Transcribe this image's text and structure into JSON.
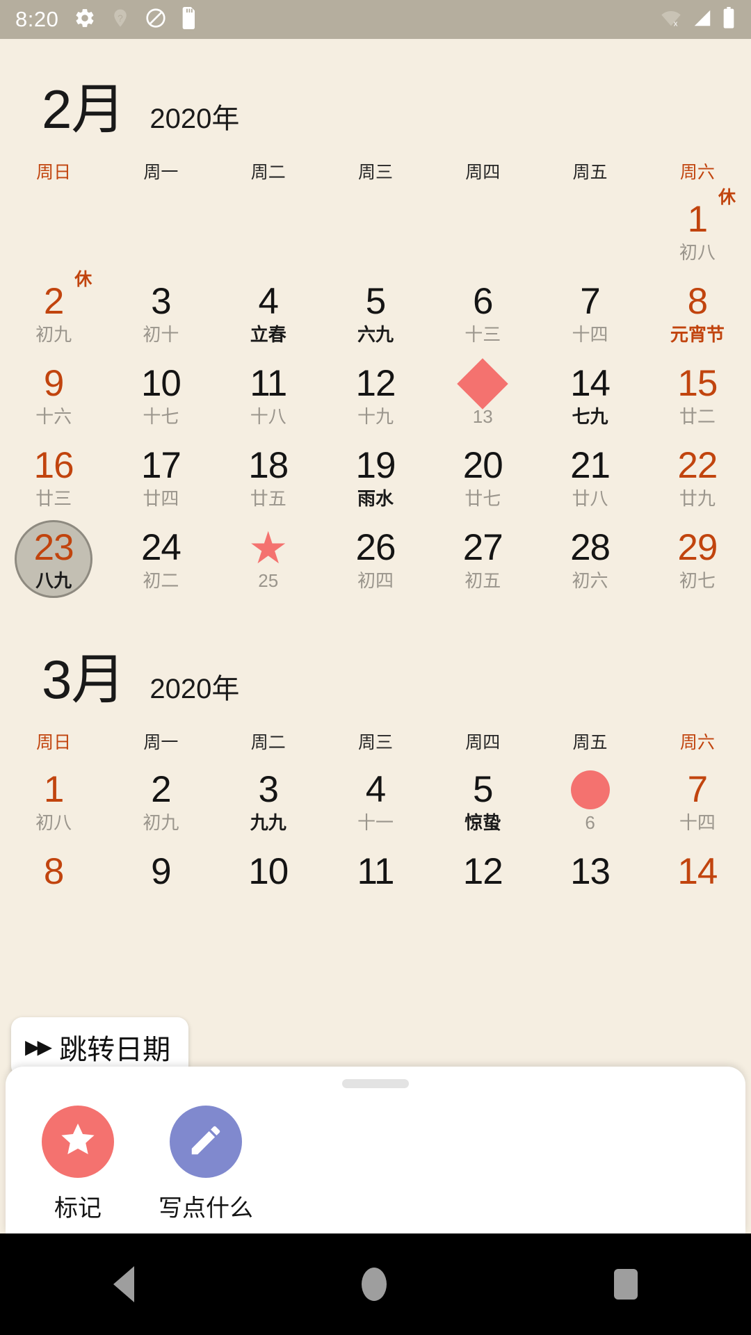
{
  "status_bar": {
    "time": "8:20",
    "left_icons": [
      "gear-icon",
      "location-unknown-icon",
      "do-not-disturb-icon",
      "sd-card-icon"
    ],
    "right_icons": [
      "wifi-off-icon",
      "signal-icon",
      "battery-icon"
    ],
    "background": "#B5AE9E"
  },
  "colors": {
    "page_background": "#F5EEE1",
    "accent_red": "#C1440E",
    "marker_salmon": "#F4726F",
    "write_purple": "#8089CE",
    "selected_gray": "#C3BFB3",
    "lunar_gray": "#9A958C"
  },
  "weekday_headers": [
    {
      "label": "周日",
      "weekend": true
    },
    {
      "label": "周一",
      "weekend": false
    },
    {
      "label": "周二",
      "weekend": false
    },
    {
      "label": "周三",
      "weekend": false
    },
    {
      "label": "周四",
      "weekend": false
    },
    {
      "label": "周五",
      "weekend": false
    },
    {
      "label": "周六",
      "weekend": true
    }
  ],
  "months": [
    {
      "month_label": "2月",
      "year_label": "2020年",
      "weeks": [
        [
          {
            "empty": true
          },
          {
            "empty": true
          },
          {
            "empty": true
          },
          {
            "empty": true
          },
          {
            "empty": true
          },
          {
            "empty": true
          },
          {
            "day": "1",
            "lunar": "初八",
            "red": true,
            "rest": "休"
          }
        ],
        [
          {
            "day": "2",
            "lunar": "初九",
            "red": true,
            "rest": "休"
          },
          {
            "day": "3",
            "lunar": "初十"
          },
          {
            "day": "4",
            "lunar": "立春",
            "lunar_strong": true
          },
          {
            "day": "5",
            "lunar": "六九",
            "lunar_strong": true
          },
          {
            "day": "6",
            "lunar": "十三"
          },
          {
            "day": "7",
            "lunar": "十四"
          },
          {
            "day": "8",
            "lunar": "元宵节",
            "red": true,
            "lunar_strong": true
          }
        ],
        [
          {
            "day": "9",
            "lunar": "十六",
            "red": true
          },
          {
            "day": "10",
            "lunar": "十七"
          },
          {
            "day": "11",
            "lunar": "十八"
          },
          {
            "day": "12",
            "lunar": "十九"
          },
          {
            "day": "13",
            "lunar": "13",
            "marker": "diamond"
          },
          {
            "day": "14",
            "lunar": "七九",
            "lunar_strong": true
          },
          {
            "day": "15",
            "lunar": "廿二",
            "red": true
          }
        ],
        [
          {
            "day": "16",
            "lunar": "廿三",
            "red": true
          },
          {
            "day": "17",
            "lunar": "廿四"
          },
          {
            "day": "18",
            "lunar": "廿五"
          },
          {
            "day": "19",
            "lunar": "雨水",
            "lunar_strong": true
          },
          {
            "day": "20",
            "lunar": "廿七"
          },
          {
            "day": "21",
            "lunar": "廿八"
          },
          {
            "day": "22",
            "lunar": "廿九",
            "red": true
          }
        ],
        [
          {
            "day": "23",
            "lunar": "八九",
            "red": true,
            "lunar_strong": true,
            "selected": true
          },
          {
            "day": "24",
            "lunar": "初二"
          },
          {
            "day": "25",
            "lunar": "25",
            "marker": "star"
          },
          {
            "day": "26",
            "lunar": "初四"
          },
          {
            "day": "27",
            "lunar": "初五"
          },
          {
            "day": "28",
            "lunar": "初六"
          },
          {
            "day": "29",
            "lunar": "初七",
            "red": true
          }
        ]
      ]
    },
    {
      "month_label": "3月",
      "year_label": "2020年",
      "weeks": [
        [
          {
            "day": "1",
            "lunar": "初八",
            "red": true
          },
          {
            "day": "2",
            "lunar": "初九"
          },
          {
            "day": "3",
            "lunar": "九九",
            "lunar_strong": true
          },
          {
            "day": "4",
            "lunar": "十一"
          },
          {
            "day": "5",
            "lunar": "惊蛰",
            "lunar_strong": true
          },
          {
            "day": "6",
            "lunar": "6",
            "marker": "circle"
          },
          {
            "day": "7",
            "lunar": "十四",
            "red": true
          }
        ],
        [
          {
            "day": "8",
            "red": true
          },
          {
            "day": "9"
          },
          {
            "day": "10"
          },
          {
            "day": "11"
          },
          {
            "day": "12"
          },
          {
            "day": "13"
          },
          {
            "day": "14",
            "red": true
          }
        ]
      ]
    }
  ],
  "jump_button": {
    "icon": "double-arrow-right-icon",
    "arrows": "▶▶",
    "label": "跳转日期"
  },
  "bottom_sheet": {
    "actions": [
      {
        "icon": "star-icon",
        "label": "标记",
        "color": "#F4726F"
      },
      {
        "icon": "pencil-icon",
        "label": "写点什么",
        "color": "#8089CE"
      }
    ]
  },
  "nav_bar": {
    "buttons": [
      "back-button",
      "home-button",
      "recents-button"
    ]
  }
}
